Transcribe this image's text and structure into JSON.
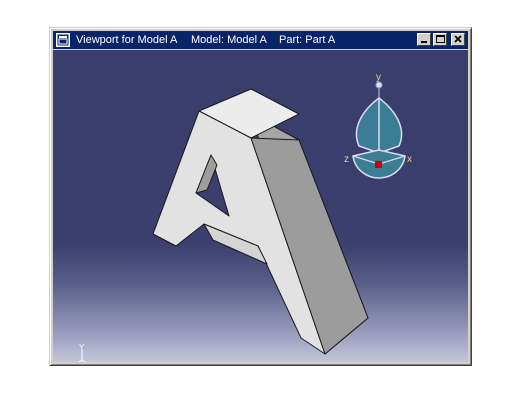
{
  "window": {
    "title": {
      "viewport": "Viewport for Model A",
      "model": "Model: Model A",
      "part": "Part: Part A"
    },
    "controls": {
      "minimize_icon": "minimize-icon",
      "maximize_icon": "maximize-icon",
      "close_icon": "close-icon"
    }
  },
  "viewport": {
    "model_shape": "letter-A",
    "view_triad": {
      "y": "y",
      "z": "z",
      "x": "x"
    },
    "axis_triad": {
      "y": "Y",
      "z": "Z",
      "x": "X"
    },
    "colors": {
      "background_top": "#3a3e6c",
      "background_bottom": "#c4c5dc",
      "model_light": "#ececec",
      "model_mid": "#d6d6d6",
      "model_dark": "#a8a8a8",
      "compass_fill": "#3c7d96",
      "compass_marker": "#d00000",
      "axis_label": "#e8d060"
    }
  }
}
